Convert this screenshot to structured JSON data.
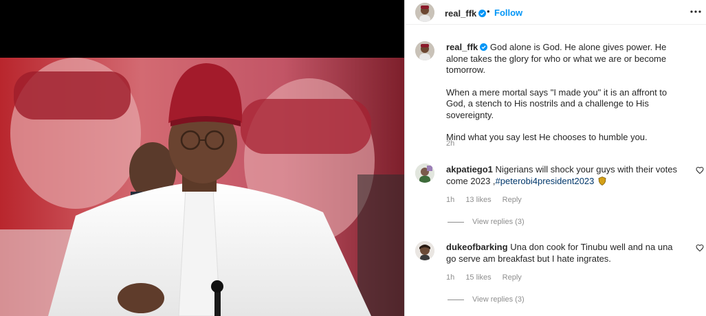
{
  "post": {
    "author": "real_ffk",
    "separator": "•",
    "follow_label": "Follow",
    "caption_author": "real_ffk",
    "caption_paragraphs": [
      "God alone is God. He alone gives power. He alone takes the glory for who or what we are or become tomorrow.",
      "When a mere mortal says \"I made you\" it is an affront to God, a stench to His nostrils and a challenge to His sovereignty.",
      "Mind what you say lest He chooses to humble you."
    ],
    "time": "2h"
  },
  "comments": [
    {
      "username": "akpatiego1",
      "text": "Nigerians will shock your guys with their votes come 2023 ,",
      "hashtag": "#peterobi4president2023",
      "time": "1h",
      "likes": "13 likes",
      "reply_label": "Reply",
      "view_replies": "View replies (3)"
    },
    {
      "username": "dukeofbarking",
      "text": "Una don cook for Tinubu well and na una go serve am breakfast but I hate ingrates.",
      "time": "1h",
      "likes": "15 likes",
      "reply_label": "Reply",
      "view_replies": "View replies (3)"
    }
  ],
  "colors": {
    "accent": "#0095f6",
    "hashtag": "#00376b",
    "muted": "#8e8e8e"
  },
  "icons": [
    "verified-badge-icon",
    "more-options-icon",
    "heart-icon",
    "shield-emoji-icon"
  ]
}
